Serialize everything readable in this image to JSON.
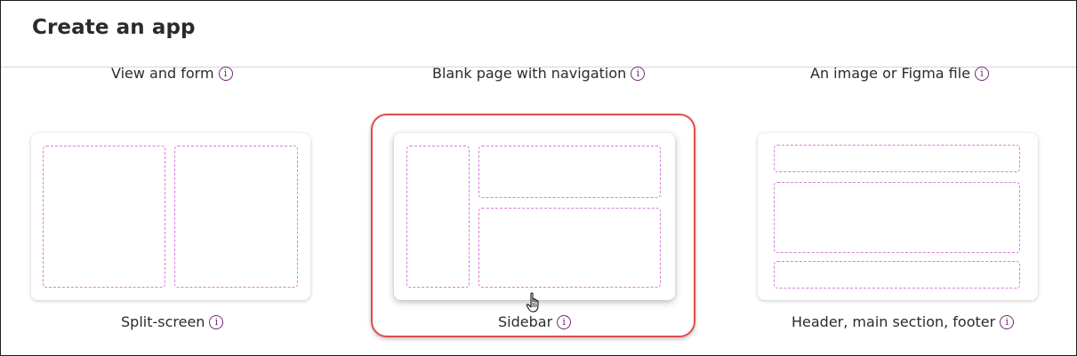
{
  "dialog": {
    "title": "Create an app"
  },
  "layouts": {
    "view_form": {
      "label": "View and form",
      "info_icon": "info-icon"
    },
    "blank_nav": {
      "label": "Blank page with navigation",
      "info_icon": "info-icon"
    },
    "image_figma": {
      "label": "An image or Figma file",
      "info_icon": "info-icon"
    },
    "split_screen": {
      "label": "Split-screen",
      "info_icon": "info-icon"
    },
    "sidebar": {
      "label": "Sidebar",
      "info_icon": "info-icon",
      "selected": true
    },
    "header_main_footer": {
      "label": "Header, main section, footer",
      "info_icon": "info-icon"
    }
  },
  "info_glyph": "i",
  "colors": {
    "accent": "#742774",
    "zone_dash": "#d77fd7",
    "selection": "#e04a4a"
  }
}
